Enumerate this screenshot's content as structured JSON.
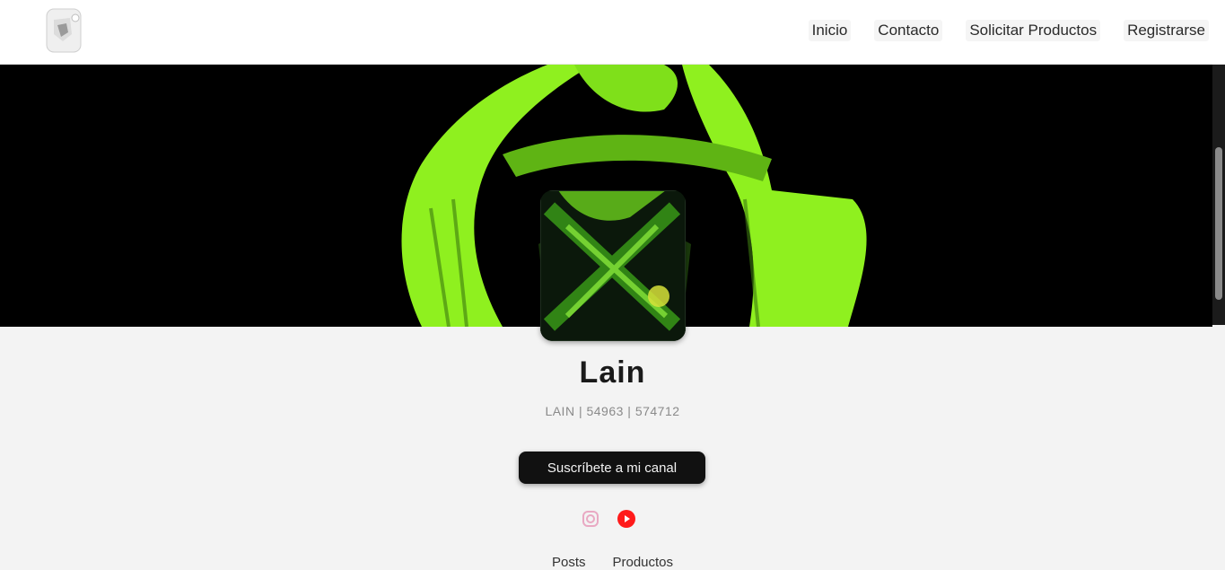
{
  "nav": {
    "logo_icon": "brand-mark",
    "links": [
      {
        "label": "Inicio"
      },
      {
        "label": "Contacto"
      },
      {
        "label": "Solicitar Productos"
      },
      {
        "label": "Registrarse"
      }
    ]
  },
  "banner": {
    "image": "green-neon-3d-render"
  },
  "profile": {
    "avatar": "green-neon-avatar",
    "name": "Lain",
    "meta": "LAIN | 54963 | 574712",
    "cta_label": "Suscríbete a mi canal",
    "social": [
      {
        "icon": "instagram-icon"
      },
      {
        "icon": "youtube-icon"
      }
    ],
    "tabs": [
      {
        "label": "Posts"
      },
      {
        "label": "Productos"
      }
    ]
  },
  "colors": {
    "accent": "#8ff01f",
    "background": "#f3f3f3",
    "button": "#111111",
    "youtube": "#ff1a1a"
  }
}
